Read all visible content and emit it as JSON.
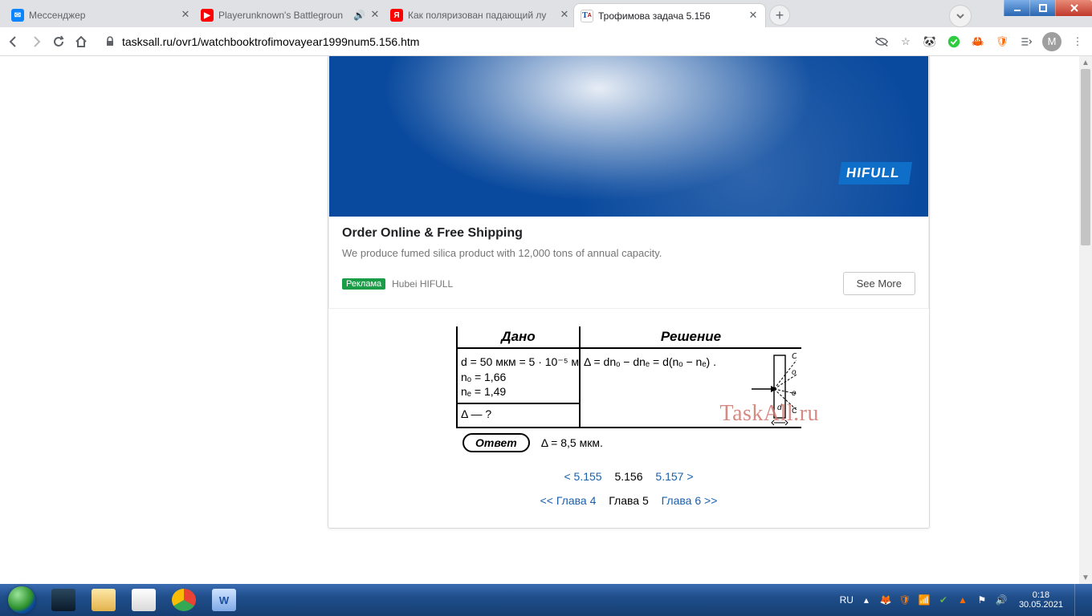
{
  "tabs": [
    {
      "title": "Мессенджер",
      "fav_bg": "#0a84ff",
      "fav_txt": "",
      "audio": false
    },
    {
      "title": "Playerunknown's Battlegroun",
      "fav_bg": "#ff0000",
      "fav_txt": "▶",
      "audio": true
    },
    {
      "title": "Как поляризован падающий лу",
      "fav_bg": "#ff0000",
      "fav_txt": "Я",
      "audio": false
    },
    {
      "title": "Трофимова задача 5.156",
      "fav_bg": "#ffffff",
      "fav_txt": "T",
      "audio": false
    }
  ],
  "active_tab": 3,
  "omnibox": {
    "url": "tasksall.ru/ovr1/watchbooktrofimovayear1999num5.156.htm"
  },
  "toolbar": {
    "avatar_letter": "M"
  },
  "ad": {
    "brand": "HIFULL",
    "title": "Order Online & Free Shipping",
    "desc": "We produce fumed silica product with 12,000 tons of annual capacity.",
    "badge": "Реклама",
    "source": "Hubei HIFULL",
    "cta": "See More"
  },
  "solution": {
    "hdr_given": "Дано",
    "hdr_solve": "Решение",
    "given": [
      "d = 50 мкм = 5 · 10⁻⁵ м",
      "nₒ = 1,66",
      "nₑ = 1,49"
    ],
    "find": "Δ — ?",
    "formula": "Δ = dnₒ − dnₑ = d(nₒ − nₑ) .",
    "answer_label": "Ответ",
    "answer": "Δ = 8,5 мкм."
  },
  "watermark": "TaskAll.ru",
  "pager": {
    "prev": "< 5.155",
    "current": "5.156",
    "next": "5.157 >",
    "chap_prev": "<< Глава 4",
    "chap_current": "Глава 5",
    "chap_next": "Глава 6 >>"
  },
  "tray": {
    "lang": "RU",
    "time": "0:18",
    "date": "30.05.2021"
  }
}
